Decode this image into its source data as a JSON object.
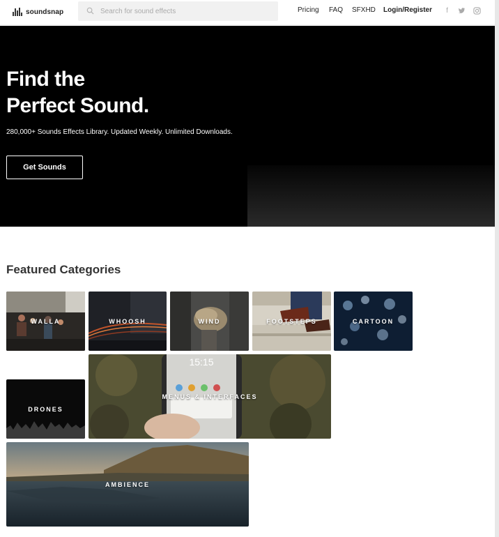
{
  "header": {
    "logo_text": "soundsnap",
    "search_placeholder": "Search for sound effects",
    "nav": {
      "pricing": "Pricing",
      "faq": "FAQ",
      "sfxhd": "SFXHD",
      "login": "Login/Register"
    },
    "social": [
      "facebook-icon",
      "twitter-icon",
      "instagram-icon"
    ]
  },
  "hero": {
    "title_line1": "Find the",
    "title_line2": "Perfect Sound.",
    "subtitle": "280,000+ Sounds Effects Library. Updated Weekly. Unlimited Downloads.",
    "cta": "Get Sounds"
  },
  "featured": {
    "title": "Featured Categories",
    "categories": [
      {
        "label": "WALLA"
      },
      {
        "label": "WHOOSH"
      },
      {
        "label": "WIND"
      },
      {
        "label": "FOOTSTEPS"
      },
      {
        "label": "CARTOON"
      },
      {
        "label": "DRONES"
      },
      {
        "label": "MENUS & INTERFACES"
      },
      {
        "label": "AMBIENCE"
      }
    ]
  },
  "colors": {
    "hero_bg": "#000000",
    "text_dark": "#333333",
    "accent_white": "#ffffff"
  }
}
